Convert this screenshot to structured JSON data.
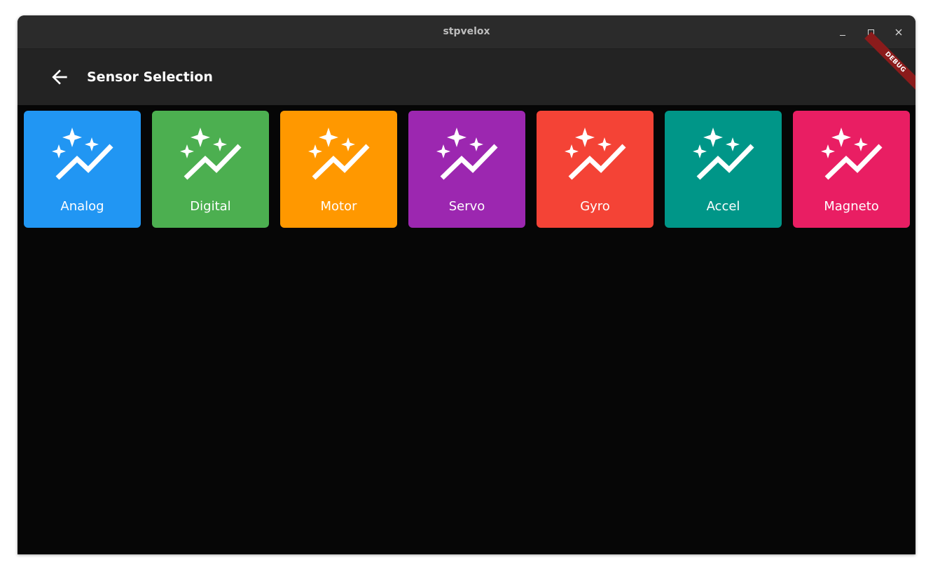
{
  "window": {
    "title": "stpvelox"
  },
  "appbar": {
    "title": "Sensor Selection",
    "back_icon": "arrow-back-icon",
    "debug_banner": "DEBUG"
  },
  "sensors": [
    {
      "label": "Analog",
      "color": "#2196f3",
      "icon": "auto-graph-icon"
    },
    {
      "label": "Digital",
      "color": "#4caf50",
      "icon": "auto-graph-icon"
    },
    {
      "label": "Motor",
      "color": "#ff9800",
      "icon": "auto-graph-icon"
    },
    {
      "label": "Servo",
      "color": "#9c27b0",
      "icon": "auto-graph-icon"
    },
    {
      "label": "Gyro",
      "color": "#f44336",
      "icon": "auto-graph-icon"
    },
    {
      "label": "Accel",
      "color": "#009688",
      "icon": "auto-graph-icon"
    },
    {
      "label": "Magneto",
      "color": "#e91e63",
      "icon": "auto-graph-icon"
    }
  ]
}
